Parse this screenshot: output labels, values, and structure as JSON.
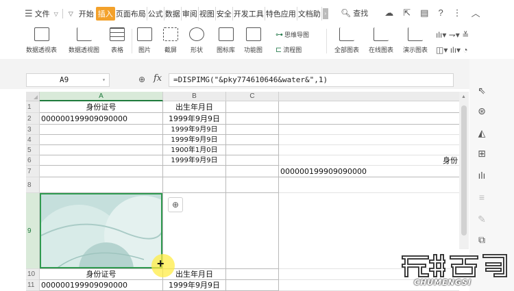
{
  "menu": {
    "file_label": "文件",
    "start_label": "开始",
    "tabs": [
      "插入",
      "页面布局",
      "公式",
      "数据",
      "审阅",
      "视图",
      "安全",
      "开发工具",
      "特色应用",
      "文档助"
    ],
    "active_tab": "插入",
    "search_label": "查找"
  },
  "ribbon": {
    "pivot_table": "数据透视表",
    "pivot_chart": "数据透视图",
    "table": "表格",
    "picture": "图片",
    "screenshot": "截屏",
    "shapes": "形状",
    "icon_lib": "图标库",
    "function_chart": "功能图",
    "mindmap": "思维导图",
    "flowchart": "流程图",
    "all_charts": "全部图表",
    "online_charts": "在线图表",
    "demo_charts": "演示图表"
  },
  "formula_bar": {
    "name_box": "A9",
    "fx": "fx",
    "formula": "=DISPIMG(\"&pky774610646&water&\",1)"
  },
  "columns": [
    "A",
    "B",
    "C"
  ],
  "row_numbers": [
    "1",
    "2",
    "3",
    "4",
    "5",
    "6",
    "7",
    "8",
    "9",
    "10",
    "11"
  ],
  "cells": {
    "A1": "身份证号",
    "B1": "出生年月日",
    "A2": "000000199909090000",
    "B2": "1999年9月9日",
    "B3": "1999年9月9日",
    "B4": "1999年9月9日",
    "B5": "1900年1月0日",
    "B6": "1999年9月9日",
    "D6": "身份",
    "D7": "000000199909090000",
    "A10": "身份证号",
    "B10": "出生年月日",
    "A11": "000000199909090000",
    "B11": "1999年9月9日"
  },
  "watermark": {
    "text": "CHUMENGSI"
  }
}
